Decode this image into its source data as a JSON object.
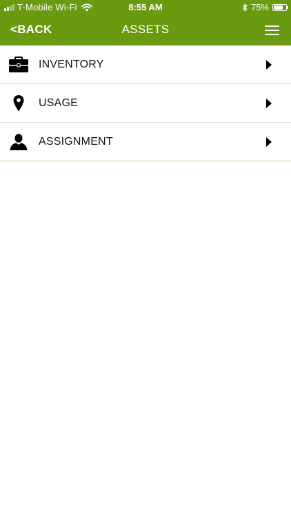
{
  "status_bar": {
    "carrier": "T-Mobile Wi-Fi",
    "time": "8:55 AM",
    "battery_percent_label": "75%",
    "battery_level": 0.75
  },
  "nav": {
    "back_label": "<BACK",
    "title": "ASSETS",
    "menu_icon": "hamburger-menu-icon"
  },
  "menu_items": [
    {
      "label": "INVENTORY",
      "icon": "briefcase-icon"
    },
    {
      "label": "USAGE",
      "icon": "map-pin-icon"
    },
    {
      "label": "ASSIGNMENT",
      "icon": "person-icon"
    }
  ],
  "colors": {
    "header_bg": "#6a9a10",
    "header_text": "#ffffff",
    "list_divider": "#d8d8d8",
    "list_bottom_border": "#b9cf90"
  }
}
